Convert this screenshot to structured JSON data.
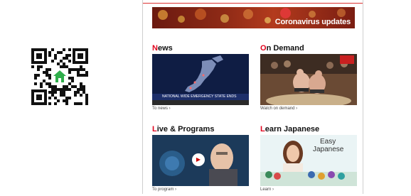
{
  "banner": {
    "text": "Coronavirus updates"
  },
  "sections": {
    "news": {
      "first_letter": "N",
      "rest": "ews",
      "caption": "To news ›",
      "thumb_caption": "NATIONAL WIDE EMERGENCY STATE ENDS"
    },
    "on_demand": {
      "first_letter": "O",
      "rest": "n Demand",
      "caption": "Watch on demand ›"
    },
    "live": {
      "first_letter": "L",
      "rest": "ive & Programs",
      "caption": "To program ›",
      "play_label": "▶"
    },
    "japanese": {
      "first_letter": "L",
      "rest": "earn Japanese",
      "caption": "Learn ›",
      "thumb_title_1": "Easy",
      "thumb_title_2": "Japanese"
    }
  },
  "colors": {
    "accent": "#e0001b",
    "banner": "#8e2a16",
    "qr_icon": "#2fae4b"
  }
}
